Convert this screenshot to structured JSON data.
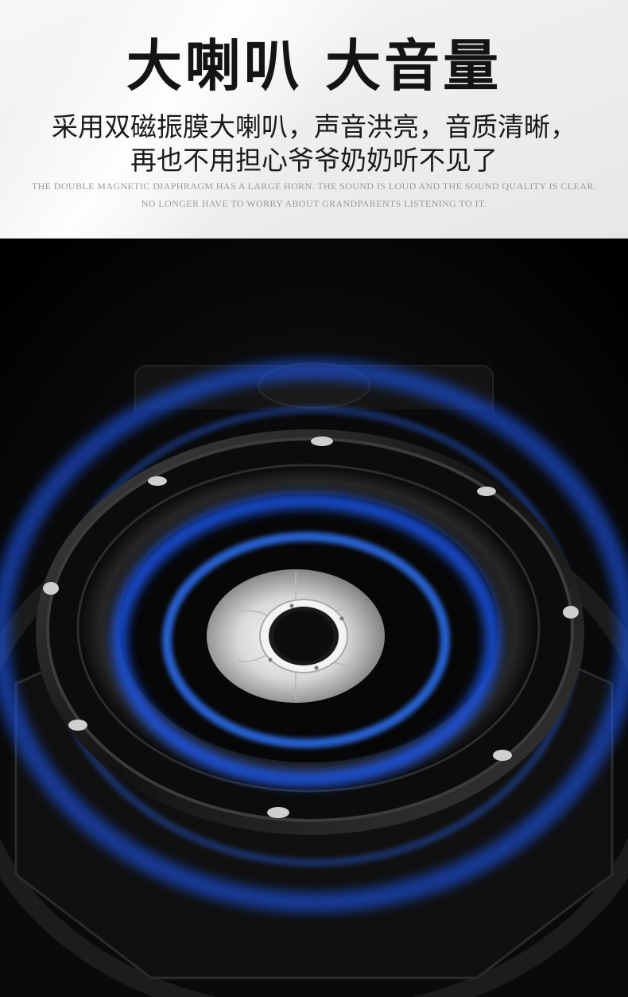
{
  "header": {
    "title": "大喇叭 大音量",
    "desc_line1": "采用双磁振膜大喇叭，声音洪亮，音质清晰，",
    "desc_line2": "再也不用担心爷爷奶奶听不见了",
    "en_line1": "THE DOUBLE MAGNETIC DIAPHRAGM HAS A LARGE HORN. THE SOUND IS LOUD AND THE SOUND QUALITY IS CLEAR.",
    "en_line2": "NO LONGER HAVE TO WORRY ABOUT GRANDPARENTS LISTENING TO IT."
  },
  "visual": {
    "subject": "speaker-driver-image",
    "wave_color": "#1e5bff",
    "cone_color": "#e8e8e8",
    "frame_color": "#151515"
  }
}
